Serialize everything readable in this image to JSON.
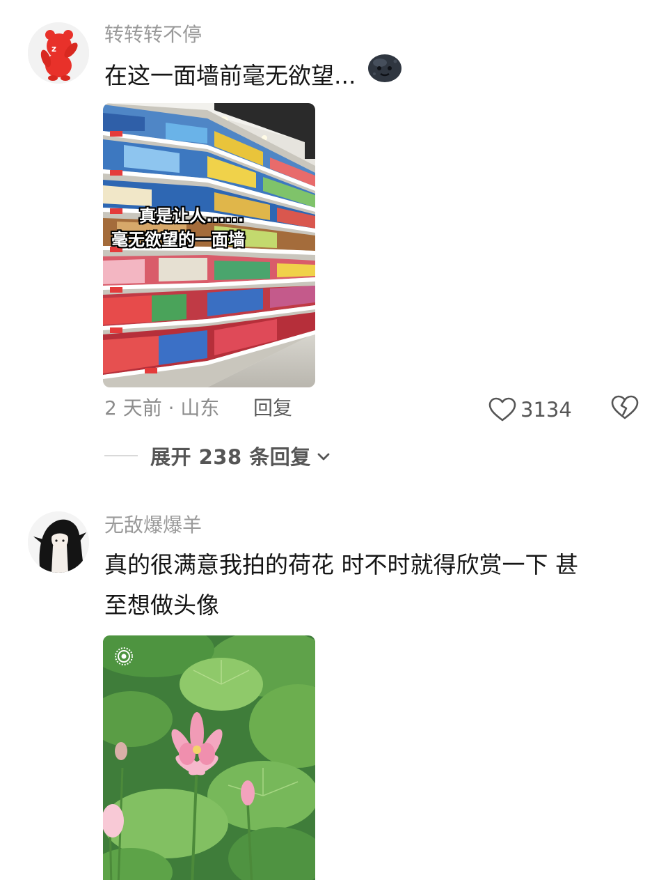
{
  "comments": [
    {
      "username": "转转转不停",
      "text": "在这一面墙前毫无欲望...",
      "emoji": "new-moon-face-emoji",
      "image": {
        "icon": "supermarket-shelf-photo",
        "overlay_line1": "真是让人......",
        "overlay_line2": "毫无欲望的一面墙"
      },
      "time_location": "2 天前 · 山东",
      "reply_label": "回复",
      "like_count": "3134",
      "expand_label": "展开 238 条回复"
    },
    {
      "username": "无敌爆爆羊",
      "text_line1": "真的很满意我拍的荷花 时不时就得欣赏一下 甚",
      "text_line2": "至想做头像",
      "image": {
        "icon": "lotus-flower-photo"
      }
    }
  ],
  "colors": {
    "username": "#9a9a9a",
    "meta": "#8c8c8c",
    "text": "#151515"
  }
}
